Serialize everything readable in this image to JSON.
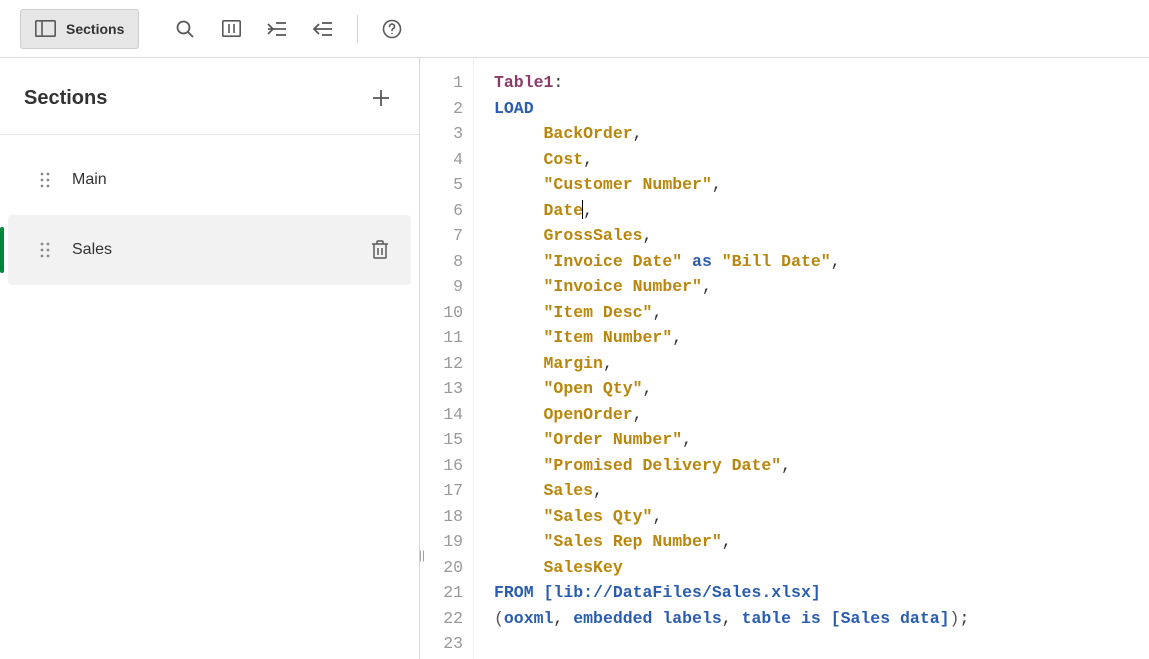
{
  "toolbar": {
    "sections_label": "Sections"
  },
  "sidebar": {
    "title": "Sections",
    "items": [
      {
        "label": "Main",
        "active": false
      },
      {
        "label": "Sales",
        "active": true
      }
    ]
  },
  "editor": {
    "line_count": 23,
    "code": {
      "table_name": "Table1",
      "load_kw": "LOAD",
      "as_kw": "as",
      "from_kw": "FROM",
      "from_path": "[lib://DataFiles/Sales.xlsx]",
      "options_line": "(ooxml, embedded labels, table is [Sales data]);",
      "options": {
        "ooxml": "ooxml",
        "embedded_labels": "embedded labels",
        "table_is": "table is",
        "table_ref": "[Sales data]"
      },
      "fields": [
        "BackOrder",
        "Cost",
        "\"Customer Number\"",
        "Date",
        "GrossSales",
        "\"Invoice Date\"",
        "\"Bill Date\"",
        "\"Invoice Number\"",
        "\"Item Desc\"",
        "\"Item Number\"",
        "Margin",
        "\"Open Qty\"",
        "OpenOrder",
        "\"Order Number\"",
        "\"Promised Delivery Date\"",
        "Sales",
        "\"Sales Qty\"",
        "\"Sales Rep Number\"",
        "SalesKey"
      ]
    }
  }
}
